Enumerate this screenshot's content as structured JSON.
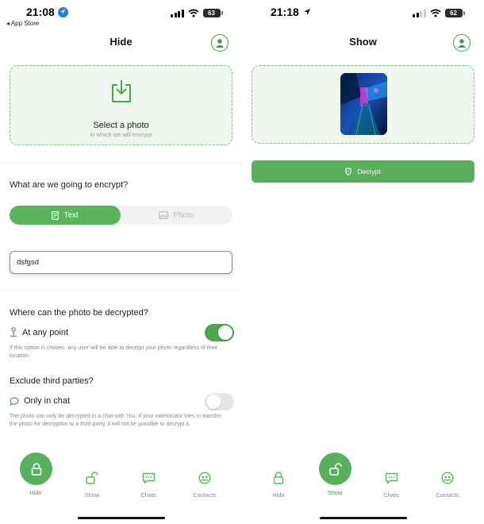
{
  "colors": {
    "accent": "#5ab35d",
    "accent_dark": "#3f9a41",
    "zone_bg": "#eef6ee",
    "zone_border": "#7cc47f"
  },
  "left": {
    "status": {
      "time": "21:08",
      "back_app": "◂ App Store",
      "battery": "63"
    },
    "title": "Hide",
    "dropzone": {
      "title": "Select a photo",
      "subtitle": "in which we will encrypt"
    },
    "encrypt_question": "What are we going to encrypt?",
    "segment": {
      "text_label": "Text",
      "photo_label": "Photo",
      "selected": "Text"
    },
    "text_input": {
      "value": "dsfgsd"
    },
    "decrypt_place_question": "Where can the photo be decrypted?",
    "any_point": {
      "label": "At any point",
      "enabled": true,
      "description": "If this option is chosen, any user will be able to decrypt your photo regardless of their location"
    },
    "exclude_question": "Exclude third parties?",
    "only_chat": {
      "label": "Only in chat",
      "enabled": false,
      "description": "The photo can only be decrypted in a chat with You. If your interlocutor tries to transfer the photo for decryption to a third party, it will not be possible to decrypt it."
    },
    "tabs": [
      {
        "label": "Hide",
        "icon": "lock-icon",
        "active": true
      },
      {
        "label": "Show",
        "icon": "unlock-icon",
        "active": false
      },
      {
        "label": "Chats",
        "icon": "chat-icon",
        "active": false
      },
      {
        "label": "Contacts",
        "icon": "contacts-icon",
        "active": false
      }
    ]
  },
  "right": {
    "status": {
      "time": "21:18",
      "battery": "62"
    },
    "title": "Show",
    "decrypt_button": "Decrypt",
    "tabs": [
      {
        "label": "Hide",
        "icon": "lock-icon",
        "active": false
      },
      {
        "label": "Show",
        "icon": "unlock-icon",
        "active": true
      },
      {
        "label": "Chats",
        "icon": "chat-icon",
        "active": false
      },
      {
        "label": "Contacts",
        "icon": "contacts-icon",
        "active": false
      }
    ]
  }
}
